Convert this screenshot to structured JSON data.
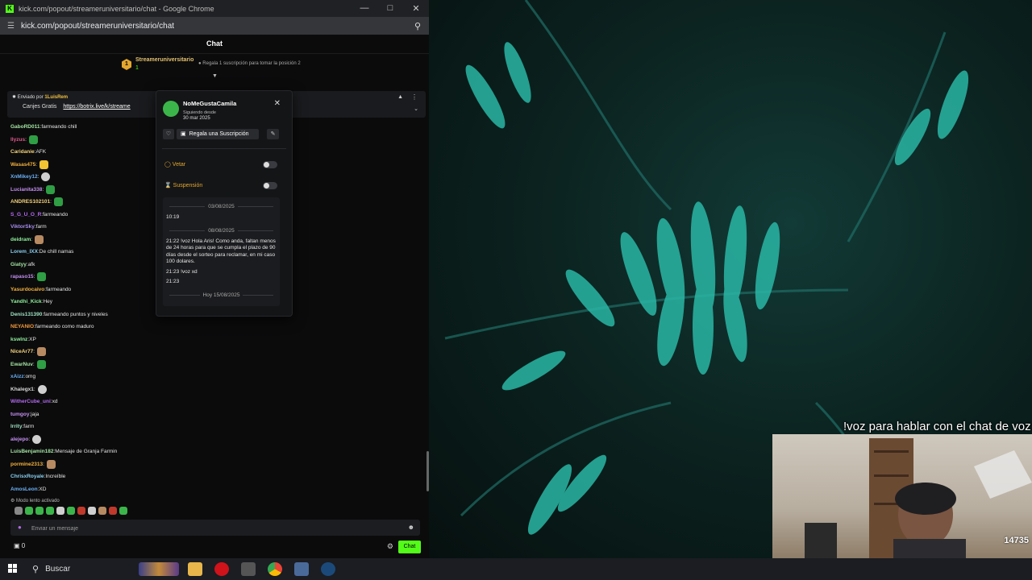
{
  "browser": {
    "window_title": "kick.com/popout/streameruniversitario/chat - Google Chrome",
    "url": "kick.com/popout/streameruniversitario/chat"
  },
  "chat": {
    "header": "Chat",
    "leader": {
      "rank": "1",
      "name": "Streameruniversitario",
      "count": "1",
      "gift_text": "Regala 1 suscripción para tomar la posición 2"
    },
    "pinned": {
      "sent_by_label": "Enviado por",
      "sent_by_user": "1LuisRem",
      "text": "Canjes Gratis",
      "link": "https://botrix.live/k/streame"
    },
    "messages": [
      {
        "user": "GaboRD011",
        "color": "#a3e3a0",
        "text": "farmeando chill",
        "emote": ""
      },
      {
        "user": "llyzus",
        "color": "#e05a8a",
        "text": "",
        "emote": "e-pepe"
      },
      {
        "user": "Caridanie",
        "color": "#f3d27a",
        "text": "AFK",
        "emote": ""
      },
      {
        "user": "Wasas475",
        "color": "#f3b13d",
        "text": "",
        "emote": "e-yellow"
      },
      {
        "user": "XnMikey12",
        "color": "#6ab0f3",
        "text": "",
        "emote": "e-ghost"
      },
      {
        "user": "Lucianita338",
        "color": "#c58ff0",
        "text": "",
        "emote": "e-pepe"
      },
      {
        "user": "ANDRES102101",
        "color": "#f3d27a",
        "text": "",
        "emote": "e-pepe"
      },
      {
        "user": "S_G_U_O_R",
        "color": "#b56af0",
        "text": "farmeando",
        "emote": ""
      },
      {
        "user": "ViktorSky",
        "color": "#a98ff0",
        "text": "farm",
        "emote": ""
      },
      {
        "user": "deidram",
        "color": "#8ff09a",
        "text": "",
        "emote": "e-cat"
      },
      {
        "user": "Lorem_IXX",
        "color": "#8ad0f0",
        "text": "De chill namas",
        "emote": ""
      },
      {
        "user": "Giatyy",
        "color": "#a3e3a0",
        "text": "afk",
        "emote": ""
      },
      {
        "user": "rapaso15",
        "color": "#c58ff0",
        "text": "",
        "emote": "e-pepe"
      },
      {
        "user": "Yasurdocaivo",
        "color": "#f3b13d",
        "text": "farmeando",
        "emote": ""
      },
      {
        "user": "Yandhi_Kick",
        "color": "#8ff09a",
        "text": "Hey",
        "emote": ""
      },
      {
        "user": "Denis131390",
        "color": "#9fe0c0",
        "text": "farmeando puntos y niveles",
        "emote": ""
      },
      {
        "user": "NEYANIO",
        "color": "#f39a3d",
        "text": "farmeando como maduro",
        "emote": ""
      },
      {
        "user": "kswlnz",
        "color": "#8ff09a",
        "text": "XP",
        "emote": ""
      },
      {
        "user": "NiceAr77",
        "color": "#f3d27a",
        "text": "",
        "emote": "e-cat"
      },
      {
        "user": "EwarNuv",
        "color": "#a3e3a0",
        "text": "",
        "emote": "e-pepe"
      },
      {
        "user": "xAizz",
        "color": "#6ab0f3",
        "text": "omg",
        "emote": ""
      },
      {
        "user": "Khalegx1",
        "color": "#d8d8d8",
        "text": "",
        "emote": "e-ghost"
      },
      {
        "user": "WitherCube_uni",
        "color": "#b56af0",
        "text": "xd",
        "emote": ""
      },
      {
        "user": "tumgoy",
        "color": "#c58ff0",
        "text": "jaja",
        "emote": ""
      },
      {
        "user": "lrrity",
        "color": "#9fe0c0",
        "text": "farm",
        "emote": ""
      },
      {
        "user": "alejepo",
        "color": "#c58ff0",
        "text": "",
        "emote": "e-ghost"
      },
      {
        "user": "LuisBenjamin182",
        "color": "#a3e3a0",
        "text": "Mensaje de Granja Farmin",
        "emote": ""
      },
      {
        "user": "pormine2313",
        "color": "#f3b13d",
        "text": "",
        "emote": "e-cat"
      },
      {
        "user": "ChrisxRoyale",
        "color": "#8ad0f0",
        "text": "Increíble",
        "emote": ""
      },
      {
        "user": "AmosLeon",
        "color": "#6ab0f3",
        "text": "XD",
        "emote": ""
      }
    ],
    "slow_mode": "Modo lento activado",
    "input_placeholder": "Enviar un mensaje",
    "points": "0",
    "send_label": "Chat"
  },
  "user_card": {
    "username": "NoMeGustaCamila",
    "following_label": "Siguiendo desde",
    "following_date": "30 mar 2025",
    "gift_button": "Regala una Suscripción",
    "veto_label": "Vetar",
    "suspend_label": "Suspensión",
    "history": [
      {
        "type": "date",
        "text": "03/08/2025"
      },
      {
        "type": "msg",
        "text": "10:19"
      },
      {
        "type": "date",
        "text": "08/08/2025"
      },
      {
        "type": "msg",
        "text": "21:22 !voz Hola Aris! Como anda, faltan menos de 24 horas para que se cumpla el plazo de 90 días desde el sorteo para reclamar, en mi caso 100 dolares."
      },
      {
        "type": "msg",
        "text": "21:23 !voz xd"
      },
      {
        "type": "msg",
        "text": "21:23"
      },
      {
        "type": "date",
        "text": "Hoy 15/08/2025"
      }
    ]
  },
  "stream": {
    "overlay_text": "!voz para hablar con el chat de voz",
    "webcam_badge": "14735"
  },
  "taskbar": {
    "search_label": "Buscar"
  },
  "colors": {
    "kick_green": "#53fc18",
    "gold": "#e3a72f"
  }
}
